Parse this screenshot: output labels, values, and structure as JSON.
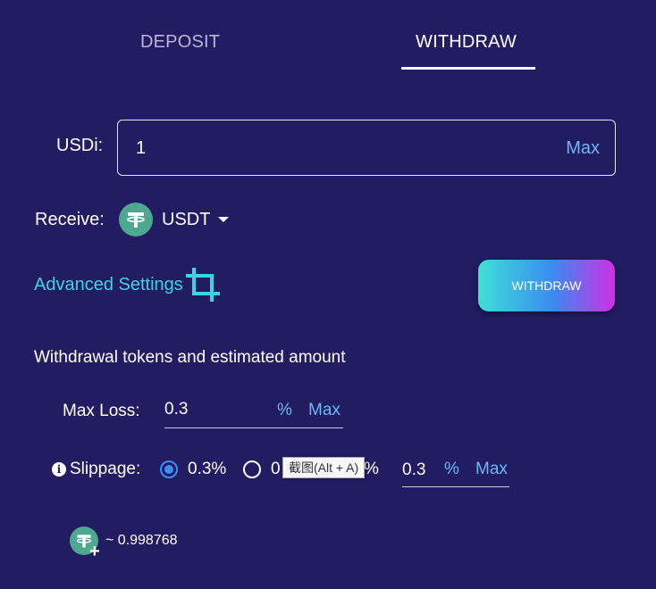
{
  "tabs": [
    {
      "label": "DEPOSIT"
    },
    {
      "label": "WITHDRAW"
    }
  ],
  "active_tab": "WITHDRAW",
  "usdi": {
    "label": "USDi:",
    "value": "1",
    "max_label": "Max"
  },
  "receive": {
    "label": "Receive:",
    "token": "USDT",
    "token_icon": "tether-icon"
  },
  "advanced": {
    "label": "Advanced Settings",
    "icon": "crop-icon"
  },
  "withdraw_button": {
    "label": "WITHDRAW"
  },
  "section_title": "Withdrawal tokens and estimated amount",
  "max_loss": {
    "label": "Max Loss:",
    "value": "0.3",
    "unit": "%",
    "max_label": "Max"
  },
  "slippage": {
    "label": "Slippage:",
    "options": [
      {
        "label": "0.3%",
        "selected": true
      },
      {
        "label": "0",
        "selected": false
      },
      {
        "label": "%",
        "selected": false
      }
    ],
    "value": "0.3",
    "unit": "%",
    "max_label": "Max"
  },
  "tooltip": "截图(Alt + A)",
  "estimated": {
    "amount": "~ 0.998768",
    "icon": "tether-icon"
  },
  "colors": {
    "background": "#221c63",
    "accent_blue": "#6fb6f2",
    "accent_cyan": "#3fd3e1",
    "tether_green": "#4ea88f",
    "radio_selected": "#3b8ff3"
  }
}
